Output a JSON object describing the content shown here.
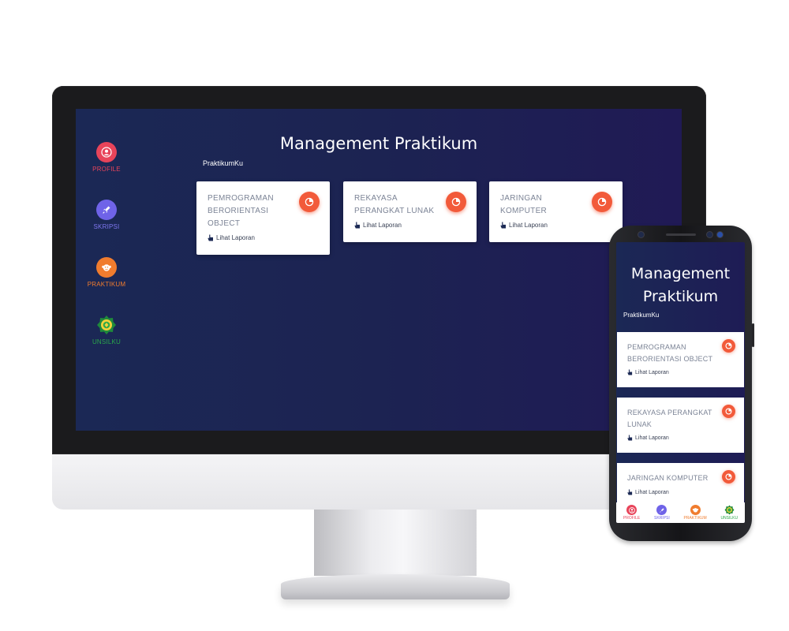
{
  "colors": {
    "accent": "#f25a3a",
    "profile": "#e8445a",
    "skripsi": "#6f63e8",
    "praktikum": "#f07c2e",
    "unsilku": "#2aa84a",
    "screen_bg": "#1c2352",
    "card_title": "#7c8496"
  },
  "desktop": {
    "title": "Management Praktikum",
    "subtitle": "PraktikumKu",
    "nav": [
      {
        "label": "PROFILE",
        "icon": "user-icon"
      },
      {
        "label": "SKRIPSI",
        "icon": "rocket-icon"
      },
      {
        "label": "PRAKTIKUM",
        "icon": "monkey-icon"
      },
      {
        "label": "UNSILKU",
        "icon": "emblem-icon"
      }
    ],
    "cards": [
      {
        "title": "PEMROGRAMAN BERORIENTASI OBJECT",
        "link": "Lihat Laporan",
        "icon": "pie-chart-icon"
      },
      {
        "title": "REKAYASA PERANGKAT LUNAK",
        "link": "Lihat Laporan",
        "icon": "pie-chart-icon"
      },
      {
        "title": "JARINGAN KOMPUTER",
        "link": "Lihat Laporan",
        "icon": "pie-chart-icon"
      }
    ]
  },
  "mobile": {
    "title": "Management Praktikum",
    "subtitle": "PraktikumKu",
    "cards": [
      {
        "title": "PEMROGRAMAN BERORIENTASI OBJECT",
        "link": "Lihat Laporan",
        "icon": "pie-chart-icon"
      },
      {
        "title": "REKAYASA PERANGKAT LUNAK",
        "link": "Lihat Laporan",
        "icon": "pie-chart-icon"
      },
      {
        "title": "JARINGAN KOMPUTER",
        "link": "Lihat Laporan",
        "icon": "pie-chart-icon"
      }
    ],
    "bottom_nav": [
      {
        "label": "PROFILE",
        "icon": "user-icon"
      },
      {
        "label": "SKRIPSI",
        "icon": "rocket-icon"
      },
      {
        "label": "PRAKTIKUM",
        "icon": "monkey-icon"
      },
      {
        "label": "UNSILKU",
        "icon": "emblem-icon"
      }
    ]
  }
}
